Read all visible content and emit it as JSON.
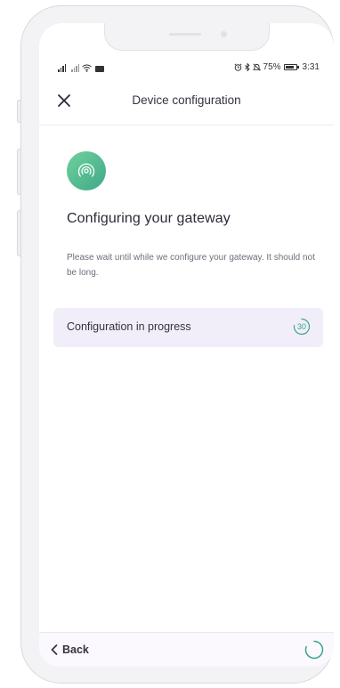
{
  "status_bar": {
    "battery_percent": "75%",
    "time": "3:31",
    "left_icons": [
      "signal-icon",
      "signal-icon",
      "wifi-icon",
      "video-icon"
    ],
    "right_icons": [
      "alarm-icon",
      "bluetooth-icon",
      "mute-icon",
      "battery-icon"
    ]
  },
  "header": {
    "title": "Device configuration",
    "close_icon": "close-icon"
  },
  "content": {
    "icon": "gateway-signal-icon",
    "title": "Configuring your gateway",
    "description": "Please wait until while we configure your gateway. It should not be long.",
    "progress": {
      "label": "Configuration in progress",
      "countdown": "30"
    }
  },
  "footer": {
    "back_label": "Back",
    "back_icon": "chevron-left-icon",
    "spinner_icon": "loading-spinner-icon"
  },
  "colors": {
    "accent_green": "#3fa88a",
    "progress_card_bg": "#f1eefa",
    "footer_bg": "#fbf8fe"
  }
}
